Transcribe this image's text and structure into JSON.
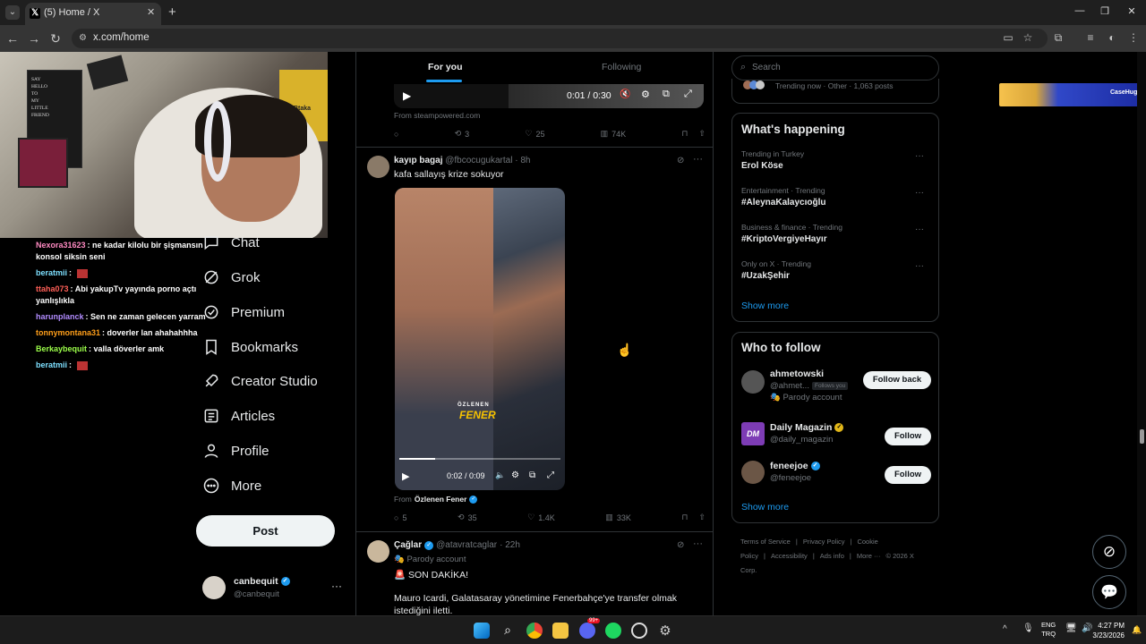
{
  "browser": {
    "tab_title": "(5) Home / X",
    "url": "x.com/home"
  },
  "stream": {
    "chat": [
      {
        "user": "Nexora31623",
        "color": "#ff8ac2",
        "text": ": ne kadar kilolu bir şişmansın konsol siksin seni"
      },
      {
        "user": "beratmii",
        "color": "#7ee0ff",
        "text": ": "
      },
      {
        "user": "ttaha073",
        "color": "#ff5f57",
        "text": ": Abi yakupTv yayında porno açtı yanlışlıkla"
      },
      {
        "user": "harunplanck",
        "color": "#b28cff",
        "text": ": Sen ne zaman gelecen yarram"
      },
      {
        "user": "tonnymontana31",
        "color": "#ff9f1a",
        "text": ": doverler lan ahahahhha"
      },
      {
        "user": "Berkaybequit",
        "color": "#9cff4a",
        "text": ": valla döverler amk"
      },
      {
        "user": "beratmii",
        "color": "#7ee0ff",
        "text": ": "
      }
    ],
    "poster_lines": [
      "SAY",
      "HELLO",
      "TO",
      "MY",
      "LITTLE",
      "FRIEND"
    ],
    "poster_tag": "Btaka"
  },
  "nav": {
    "items": [
      {
        "label": "Chat",
        "icon": "chat-icon"
      },
      {
        "label": "Grok",
        "icon": "grok-icon"
      },
      {
        "label": "Premium",
        "icon": "premium-icon"
      },
      {
        "label": "Bookmarks",
        "icon": "bookmark-icon"
      },
      {
        "label": "Creator Studio",
        "icon": "rocket-icon"
      },
      {
        "label": "Articles",
        "icon": "articles-icon"
      },
      {
        "label": "Profile",
        "icon": "profile-icon"
      },
      {
        "label": "More",
        "icon": "more-icon"
      }
    ],
    "post_label": "Post",
    "account": {
      "name": "canbequit",
      "handle": "@canbequit"
    }
  },
  "feed": {
    "tabs": {
      "for_you": "For you",
      "following": "Following"
    },
    "tweet1": {
      "video_time": "0:01 / 0:30",
      "source": "From steampowered.com",
      "stats": {
        "reposts": "3",
        "likes": "25",
        "views": "74K"
      }
    },
    "tweet2": {
      "name": "kayıp bagaj",
      "handle": "@fbcocugukartal",
      "time": "· 8h",
      "text": "kafa sallayış krize sokuyor",
      "overlay_top": "ÖZLENEN",
      "overlay_bottom": "FENER",
      "video_time": "0:02 / 0:09",
      "source_prefix": "From",
      "source_name": "Özlenen Fener",
      "stats": {
        "replies": "5",
        "reposts": "35",
        "likes": "1.4K",
        "views": "33K"
      }
    },
    "tweet3": {
      "name": "Çağlar",
      "handle": "@atavratcaglar",
      "time": "· 22h",
      "badge": "Parody account",
      "line1": "SON DAKİKA!",
      "line2": "Mauro Icardi, Galatasaray yönetimine Fenerbahçe'ye transfer olmak istediğini iletti."
    }
  },
  "right": {
    "search_placeholder": "Search",
    "trending_now": "Trending now · Other · 1,063 posts",
    "happening_title": "What's happening",
    "trends": [
      {
        "meta": "Trending in Turkey",
        "name": "Erol Köse"
      },
      {
        "meta": "Entertainment · Trending",
        "name": "#AleynaKalaycıoğlu"
      },
      {
        "meta": "Business & finance · Trending",
        "name": "#KriptoVergiyeHayır"
      },
      {
        "meta": "Only on X · Trending",
        "name": "#UzakŞehir"
      }
    ],
    "show_more": "Show more",
    "wtf_title": "Who to follow",
    "wtf": [
      {
        "name": "ahmetowski",
        "handle": "@ahmet...",
        "follows_you": "Follows you",
        "badge": "Parody account",
        "button": "Follow back"
      },
      {
        "name": "Daily Magazin",
        "handle": "@daily_magazin",
        "button": "Follow",
        "avatar_text": "DM"
      },
      {
        "name": "feneejoe",
        "handle": "@feneejoe",
        "button": "Follow"
      }
    ],
    "footer": [
      "Terms of Service",
      "|",
      "Privacy Policy",
      "|",
      "Cookie Policy",
      "|",
      "Accessibility",
      "|",
      "Ads info",
      "|",
      "More ···",
      "© 2026 X Corp."
    ]
  },
  "ad": {
    "text": "CaseHug"
  },
  "taskbar": {
    "lang1": "ENG",
    "lang2": "TRQ",
    "time": "4:27 PM",
    "date": "3/23/2026",
    "badge": "99+"
  },
  "colors": {
    "accent": "#1d9bf0",
    "bg": "#000000",
    "border": "#2f3336",
    "muted": "#71767b"
  }
}
